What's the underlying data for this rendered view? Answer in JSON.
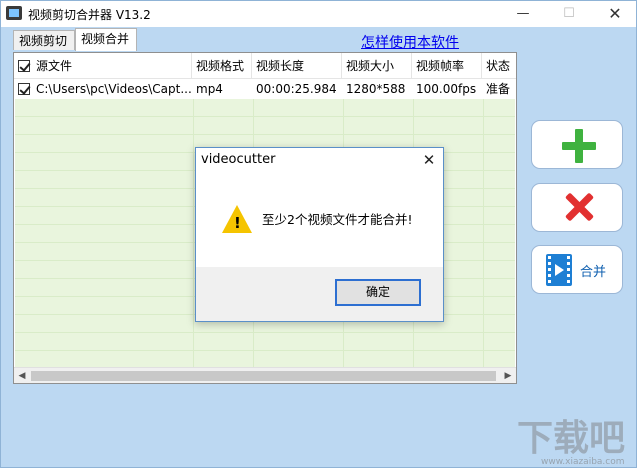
{
  "window": {
    "title": "视频剪切合并器 V13.2",
    "controls": {
      "minimize": "—",
      "maximize": "☐",
      "close": "✕"
    }
  },
  "tabs": [
    {
      "label": "视频剪切",
      "active": false
    },
    {
      "label": "视频合并",
      "active": true
    }
  ],
  "help_link": "怎样使用本软件",
  "table": {
    "columns": [
      "源文件",
      "视频格式",
      "视频长度",
      "视频大小",
      "视频帧率",
      "状态"
    ],
    "header_checked": true,
    "rows": [
      {
        "checked": true,
        "file": "C:\\Users\\pc\\Videos\\Capt...",
        "format": "mp4",
        "duration": "00:00:25.984",
        "size": "1280*588",
        "fps": "100.00fps",
        "status": "准备"
      }
    ]
  },
  "side_buttons": {
    "add_icon": "plus-icon",
    "delete_icon": "x-icon",
    "merge_icon": "film-icon",
    "merge_label": "合并"
  },
  "dialog": {
    "title": "videocutter",
    "message": "至少2个视频文件才能合并!",
    "ok_label": "确定",
    "icon": "warning-icon"
  },
  "watermark": {
    "text": "下载吧",
    "sub": "www.xiazaiba.com"
  },
  "colors": {
    "window_bg": "#bcd8f2",
    "row_green": "#e9f5dd",
    "accent_blue": "#2d6fd1",
    "add_green": "#3fb23f",
    "delete_red": "#e23030",
    "warning_yellow": "#f5c400",
    "link_blue": "#0000ee"
  }
}
